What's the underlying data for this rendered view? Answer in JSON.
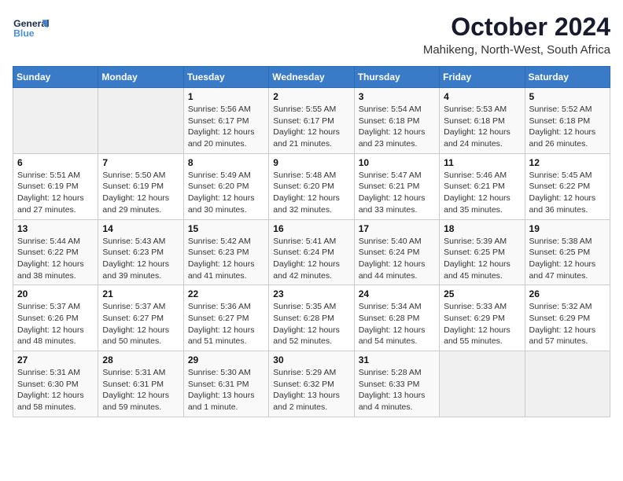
{
  "header": {
    "logo_line1": "General",
    "logo_line2": "Blue",
    "title": "October 2024",
    "subtitle": "Mahikeng, North-West, South Africa"
  },
  "days_of_week": [
    "Sunday",
    "Monday",
    "Tuesday",
    "Wednesday",
    "Thursday",
    "Friday",
    "Saturday"
  ],
  "weeks": [
    [
      {
        "day": "",
        "sunrise": "",
        "sunset": "",
        "daylight": "",
        "empty": true
      },
      {
        "day": "",
        "sunrise": "",
        "sunset": "",
        "daylight": "",
        "empty": true
      },
      {
        "day": "1",
        "sunrise": "Sunrise: 5:56 AM",
        "sunset": "Sunset: 6:17 PM",
        "daylight": "Daylight: 12 hours and 20 minutes.",
        "empty": false
      },
      {
        "day": "2",
        "sunrise": "Sunrise: 5:55 AM",
        "sunset": "Sunset: 6:17 PM",
        "daylight": "Daylight: 12 hours and 21 minutes.",
        "empty": false
      },
      {
        "day": "3",
        "sunrise": "Sunrise: 5:54 AM",
        "sunset": "Sunset: 6:18 PM",
        "daylight": "Daylight: 12 hours and 23 minutes.",
        "empty": false
      },
      {
        "day": "4",
        "sunrise": "Sunrise: 5:53 AM",
        "sunset": "Sunset: 6:18 PM",
        "daylight": "Daylight: 12 hours and 24 minutes.",
        "empty": false
      },
      {
        "day": "5",
        "sunrise": "Sunrise: 5:52 AM",
        "sunset": "Sunset: 6:18 PM",
        "daylight": "Daylight: 12 hours and 26 minutes.",
        "empty": false
      }
    ],
    [
      {
        "day": "6",
        "sunrise": "Sunrise: 5:51 AM",
        "sunset": "Sunset: 6:19 PM",
        "daylight": "Daylight: 12 hours and 27 minutes.",
        "empty": false
      },
      {
        "day": "7",
        "sunrise": "Sunrise: 5:50 AM",
        "sunset": "Sunset: 6:19 PM",
        "daylight": "Daylight: 12 hours and 29 minutes.",
        "empty": false
      },
      {
        "day": "8",
        "sunrise": "Sunrise: 5:49 AM",
        "sunset": "Sunset: 6:20 PM",
        "daylight": "Daylight: 12 hours and 30 minutes.",
        "empty": false
      },
      {
        "day": "9",
        "sunrise": "Sunrise: 5:48 AM",
        "sunset": "Sunset: 6:20 PM",
        "daylight": "Daylight: 12 hours and 32 minutes.",
        "empty": false
      },
      {
        "day": "10",
        "sunrise": "Sunrise: 5:47 AM",
        "sunset": "Sunset: 6:21 PM",
        "daylight": "Daylight: 12 hours and 33 minutes.",
        "empty": false
      },
      {
        "day": "11",
        "sunrise": "Sunrise: 5:46 AM",
        "sunset": "Sunset: 6:21 PM",
        "daylight": "Daylight: 12 hours and 35 minutes.",
        "empty": false
      },
      {
        "day": "12",
        "sunrise": "Sunrise: 5:45 AM",
        "sunset": "Sunset: 6:22 PM",
        "daylight": "Daylight: 12 hours and 36 minutes.",
        "empty": false
      }
    ],
    [
      {
        "day": "13",
        "sunrise": "Sunrise: 5:44 AM",
        "sunset": "Sunset: 6:22 PM",
        "daylight": "Daylight: 12 hours and 38 minutes.",
        "empty": false
      },
      {
        "day": "14",
        "sunrise": "Sunrise: 5:43 AM",
        "sunset": "Sunset: 6:23 PM",
        "daylight": "Daylight: 12 hours and 39 minutes.",
        "empty": false
      },
      {
        "day": "15",
        "sunrise": "Sunrise: 5:42 AM",
        "sunset": "Sunset: 6:23 PM",
        "daylight": "Daylight: 12 hours and 41 minutes.",
        "empty": false
      },
      {
        "day": "16",
        "sunrise": "Sunrise: 5:41 AM",
        "sunset": "Sunset: 6:24 PM",
        "daylight": "Daylight: 12 hours and 42 minutes.",
        "empty": false
      },
      {
        "day": "17",
        "sunrise": "Sunrise: 5:40 AM",
        "sunset": "Sunset: 6:24 PM",
        "daylight": "Daylight: 12 hours and 44 minutes.",
        "empty": false
      },
      {
        "day": "18",
        "sunrise": "Sunrise: 5:39 AM",
        "sunset": "Sunset: 6:25 PM",
        "daylight": "Daylight: 12 hours and 45 minutes.",
        "empty": false
      },
      {
        "day": "19",
        "sunrise": "Sunrise: 5:38 AM",
        "sunset": "Sunset: 6:25 PM",
        "daylight": "Daylight: 12 hours and 47 minutes.",
        "empty": false
      }
    ],
    [
      {
        "day": "20",
        "sunrise": "Sunrise: 5:37 AM",
        "sunset": "Sunset: 6:26 PM",
        "daylight": "Daylight: 12 hours and 48 minutes.",
        "empty": false
      },
      {
        "day": "21",
        "sunrise": "Sunrise: 5:37 AM",
        "sunset": "Sunset: 6:27 PM",
        "daylight": "Daylight: 12 hours and 50 minutes.",
        "empty": false
      },
      {
        "day": "22",
        "sunrise": "Sunrise: 5:36 AM",
        "sunset": "Sunset: 6:27 PM",
        "daylight": "Daylight: 12 hours and 51 minutes.",
        "empty": false
      },
      {
        "day": "23",
        "sunrise": "Sunrise: 5:35 AM",
        "sunset": "Sunset: 6:28 PM",
        "daylight": "Daylight: 12 hours and 52 minutes.",
        "empty": false
      },
      {
        "day": "24",
        "sunrise": "Sunrise: 5:34 AM",
        "sunset": "Sunset: 6:28 PM",
        "daylight": "Daylight: 12 hours and 54 minutes.",
        "empty": false
      },
      {
        "day": "25",
        "sunrise": "Sunrise: 5:33 AM",
        "sunset": "Sunset: 6:29 PM",
        "daylight": "Daylight: 12 hours and 55 minutes.",
        "empty": false
      },
      {
        "day": "26",
        "sunrise": "Sunrise: 5:32 AM",
        "sunset": "Sunset: 6:29 PM",
        "daylight": "Daylight: 12 hours and 57 minutes.",
        "empty": false
      }
    ],
    [
      {
        "day": "27",
        "sunrise": "Sunrise: 5:31 AM",
        "sunset": "Sunset: 6:30 PM",
        "daylight": "Daylight: 12 hours and 58 minutes.",
        "empty": false
      },
      {
        "day": "28",
        "sunrise": "Sunrise: 5:31 AM",
        "sunset": "Sunset: 6:31 PM",
        "daylight": "Daylight: 12 hours and 59 minutes.",
        "empty": false
      },
      {
        "day": "29",
        "sunrise": "Sunrise: 5:30 AM",
        "sunset": "Sunset: 6:31 PM",
        "daylight": "Daylight: 13 hours and 1 minute.",
        "empty": false
      },
      {
        "day": "30",
        "sunrise": "Sunrise: 5:29 AM",
        "sunset": "Sunset: 6:32 PM",
        "daylight": "Daylight: 13 hours and 2 minutes.",
        "empty": false
      },
      {
        "day": "31",
        "sunrise": "Sunrise: 5:28 AM",
        "sunset": "Sunset: 6:33 PM",
        "daylight": "Daylight: 13 hours and 4 minutes.",
        "empty": false
      },
      {
        "day": "",
        "sunrise": "",
        "sunset": "",
        "daylight": "",
        "empty": true
      },
      {
        "day": "",
        "sunrise": "",
        "sunset": "",
        "daylight": "",
        "empty": true
      }
    ]
  ]
}
